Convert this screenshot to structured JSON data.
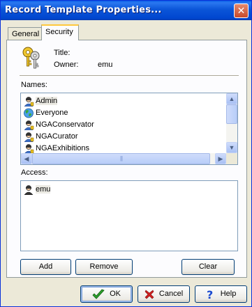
{
  "window": {
    "title": "Record Template Properties..."
  },
  "tabs": [
    {
      "label": "General"
    },
    {
      "label": "Security"
    }
  ],
  "properties": {
    "title_label": "Title:",
    "title_value": "",
    "owner_label": "Owner:",
    "owner_value": "emu"
  },
  "names": {
    "label": "Names:",
    "items": [
      {
        "label": "Admin",
        "icon": "user-icon"
      },
      {
        "label": "Everyone",
        "icon": "globe-icon"
      },
      {
        "label": "NGAConservator",
        "icon": "user-icon"
      },
      {
        "label": "NGACurator",
        "icon": "user-icon"
      },
      {
        "label": "NGAExhibitions",
        "icon": "user-icon"
      }
    ]
  },
  "access": {
    "label": "Access:",
    "items": [
      {
        "label": "emu",
        "icon": "user-icon"
      }
    ]
  },
  "panel_buttons": {
    "add": "Add",
    "remove": "Remove",
    "clear": "Clear"
  },
  "dialog_buttons": {
    "ok": "OK",
    "cancel": "Cancel",
    "help": "Help"
  },
  "colors": {
    "titlebar": "#0054e3",
    "dialog_bg": "#ece9d8",
    "panel_bg": "#fcfcfe",
    "active_tab_accent": "#ffc83c"
  }
}
